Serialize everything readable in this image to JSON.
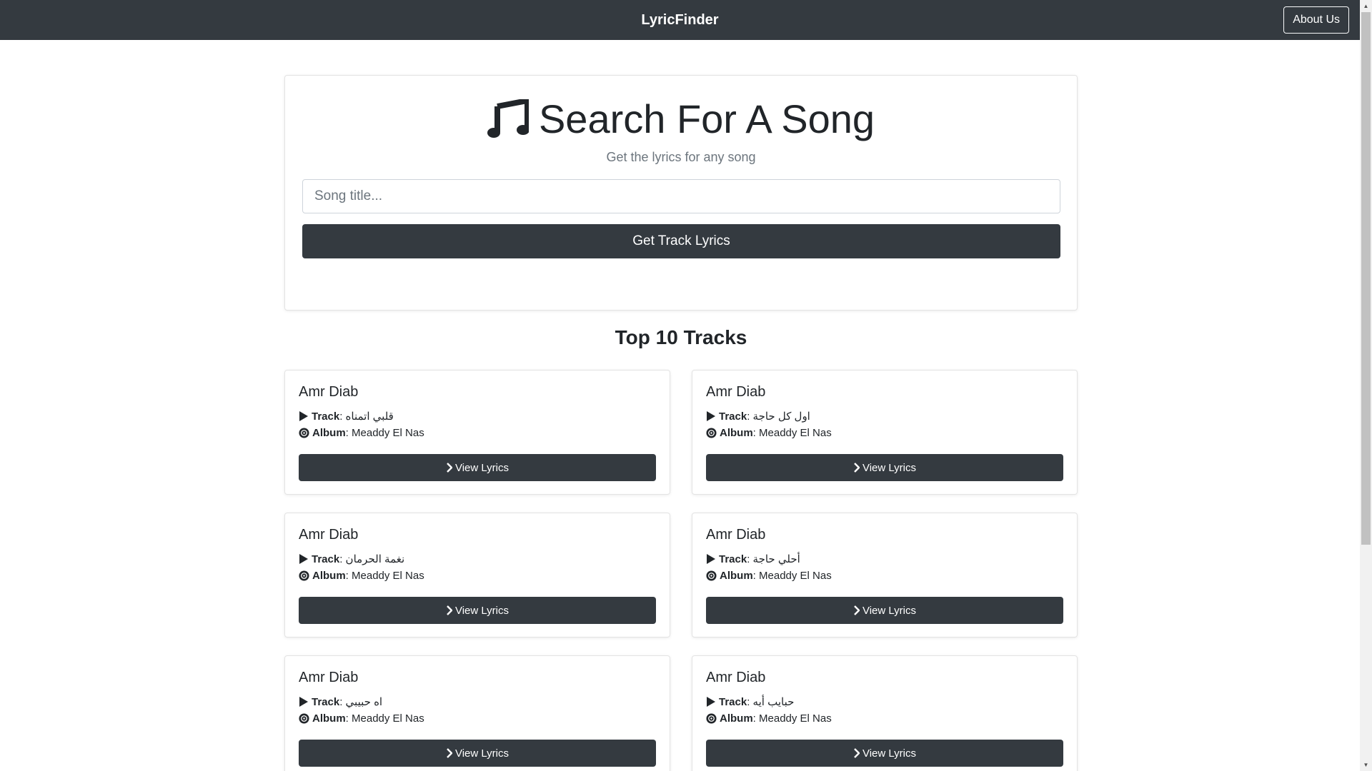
{
  "navbar": {
    "brand": "LyricFinder",
    "about_label": "About Us"
  },
  "search": {
    "title": "Search For A Song",
    "subtitle": "Get the lyrics for any song",
    "placeholder": "Song title...",
    "button_label": "Get Track Lyrics",
    "title_icon": "music-note-icon"
  },
  "tracks_section": {
    "title": "Top 10 Tracks",
    "track_label": "Track",
    "album_label": "Album",
    "view_label": "View Lyrics",
    "items": [
      {
        "artist": "Amr Diab",
        "track": "قلبي اتمناه",
        "album": "Meaddy El Nas"
      },
      {
        "artist": "Amr Diab",
        "track": "اول كل حاجة",
        "album": "Meaddy El Nas"
      },
      {
        "artist": "Amr Diab",
        "track": "نغمة الحرمان",
        "album": "Meaddy El Nas"
      },
      {
        "artist": "Amr Diab",
        "track": "أحلي حاجة",
        "album": "Meaddy El Nas"
      },
      {
        "artist": "Amr Diab",
        "track": "اه حبيبي",
        "album": "Meaddy El Nas"
      },
      {
        "artist": "Amr Diab",
        "track": "حبايب أيه",
        "album": "Meaddy El Nas"
      }
    ]
  }
}
